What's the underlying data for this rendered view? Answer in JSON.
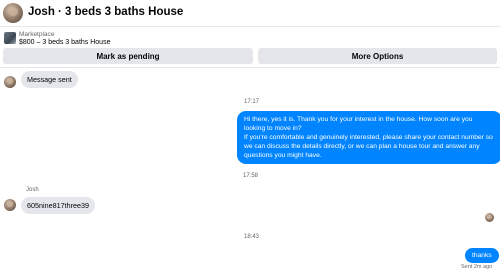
{
  "header": {
    "title": "Josh · 3 beds 3 baths House"
  },
  "listing": {
    "label": "Marketplace",
    "title": "$800 – 3 beds 3 baths House"
  },
  "actions": {
    "pending_label": "Mark as pending",
    "more_label": "More Options"
  },
  "messages": {
    "msg1": "Message sent",
    "ts1": "17:17",
    "msg2": "Hi there, yes it is. Thank you for your interest in the house. How soon are you looking to move in?\nIf you're comfortable and genuinely interested, please share your contact number so we can discuss the details directly, or we can plan a house tour and answer any questions you might have.",
    "ts2": "17:58",
    "sender": "Josh",
    "msg3": "605nine817three39",
    "ts3": "18:43",
    "msg4": "thanks",
    "status": "Sent 2m ago"
  },
  "colors": {
    "accent": "#0084ff",
    "bubble_gray": "#e4e6eb"
  }
}
